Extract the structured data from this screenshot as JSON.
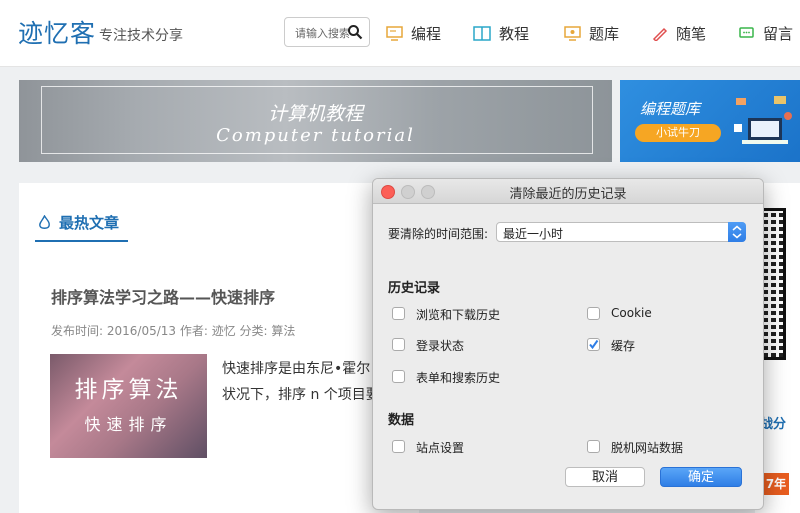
{
  "site": {
    "logo": "迹忆客",
    "tagline": "专注技术分享",
    "search_placeholder": "请输入搜索",
    "nav": [
      {
        "label": "编程",
        "icon": "monitor-icon"
      },
      {
        "label": "教程",
        "icon": "book-icon"
      },
      {
        "label": "题库",
        "icon": "quiz-icon"
      },
      {
        "label": "随笔",
        "icon": "pen-icon"
      },
      {
        "label": "留言",
        "icon": "message-icon"
      }
    ]
  },
  "banners": {
    "left_line1": "计算机教程",
    "left_line2": "Computer tutorial",
    "right_title": "编程题库",
    "right_button": "小试牛刀"
  },
  "section": {
    "title": "最热文章"
  },
  "article": {
    "title": "排序算法学习之路——快速排序",
    "meta": "发布时间: 2016/05/13 作者: 迹忆 分类: 算法",
    "thumb_line1": "排序算法",
    "thumb_line2": "快速排序",
    "excerpt_line1": "快速排序是由东尼•霍尔",
    "excerpt_line2": "状况下，排序 n 个项目要"
  },
  "sidebar": {
    "link_fragment": "战分",
    "badge": "7年"
  },
  "dialog": {
    "title": "清除最近的历史记录",
    "range_label": "要清除的时间范围:",
    "range_value": "最近一小时",
    "history_heading": "历史记录",
    "history_items": [
      {
        "label": "浏览和下载历史",
        "checked": false
      },
      {
        "label": "Cookie",
        "checked": false
      },
      {
        "label": "登录状态",
        "checked": false
      },
      {
        "label": "缓存",
        "checked": true
      },
      {
        "label": "表单和搜索历史",
        "checked": false
      }
    ],
    "data_heading": "数据",
    "data_items": [
      {
        "label": "站点设置",
        "checked": false
      },
      {
        "label": "脱机网站数据",
        "checked": false
      }
    ],
    "cancel_label": "取消",
    "ok_label": "确定",
    "colors": {
      "close": "#fc5f57",
      "accent": "#2f7ee6"
    }
  }
}
